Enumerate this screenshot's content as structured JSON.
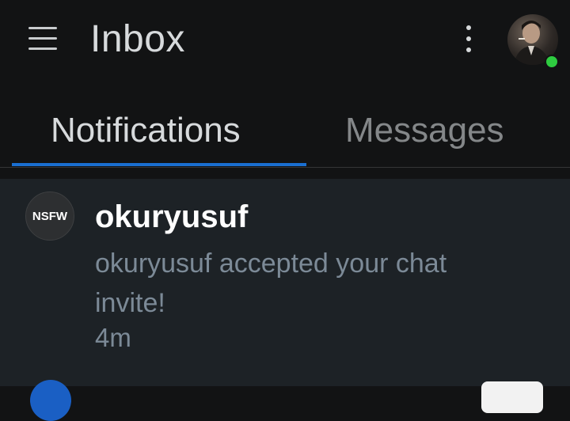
{
  "header": {
    "title": "Inbox",
    "menu_icon": "hamburger-menu-icon",
    "overflow_icon": "vertical-dots-icon",
    "avatar_status": "online",
    "status_color": "#2ecc40"
  },
  "tabs": [
    {
      "label": "Notifications",
      "selected": true
    },
    {
      "label": "Messages",
      "selected": false
    }
  ],
  "accent_color": "#1a6fd1",
  "notifications": [
    {
      "avatar_text": "NSFW",
      "title": "okuryusuf",
      "body": "okuryusuf accepted your chat invite!",
      "time": "4m"
    }
  ]
}
